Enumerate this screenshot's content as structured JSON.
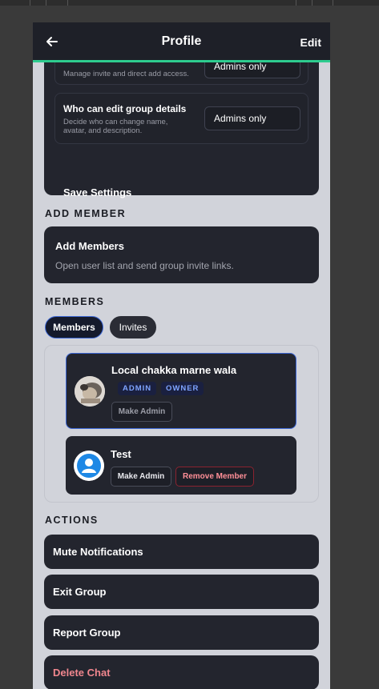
{
  "header": {
    "title": "Profile",
    "edit_label": "Edit"
  },
  "settings": {
    "invite_desc": "Manage invite and direct add access.",
    "invite_value": "Admins only",
    "edit_title": "Who can edit group details",
    "edit_desc_line1": "Decide who can change name,",
    "edit_desc_line2": "avatar, and description.",
    "edit_value": "Admins only",
    "save_label": "Save Settings"
  },
  "add_member": {
    "section": "ADD MEMBER",
    "title": "Add Members",
    "desc": "Open user list and send group invite links."
  },
  "members": {
    "section": "MEMBERS",
    "tabs": [
      {
        "label": "Members",
        "active": true
      },
      {
        "label": "Invites",
        "active": false
      }
    ],
    "list": [
      {
        "name": "Local chakka marne wala",
        "badges": [
          "ADMIN",
          "OWNER"
        ],
        "actions": [
          "Make Admin"
        ]
      },
      {
        "name": "Test",
        "badges": [],
        "actions": [
          "Make Admin",
          "Remove Member"
        ]
      }
    ]
  },
  "actions": {
    "section": "ACTIONS",
    "items": [
      "Mute Notifications",
      "Exit Group",
      "Report Group",
      "Delete Chat"
    ]
  },
  "colors": {
    "accent_green": "#2ecc8f",
    "accent_blue": "#3c67d6",
    "danger": "#f0868e",
    "card": "#23252e",
    "page_bg": "#d1d3da"
  }
}
